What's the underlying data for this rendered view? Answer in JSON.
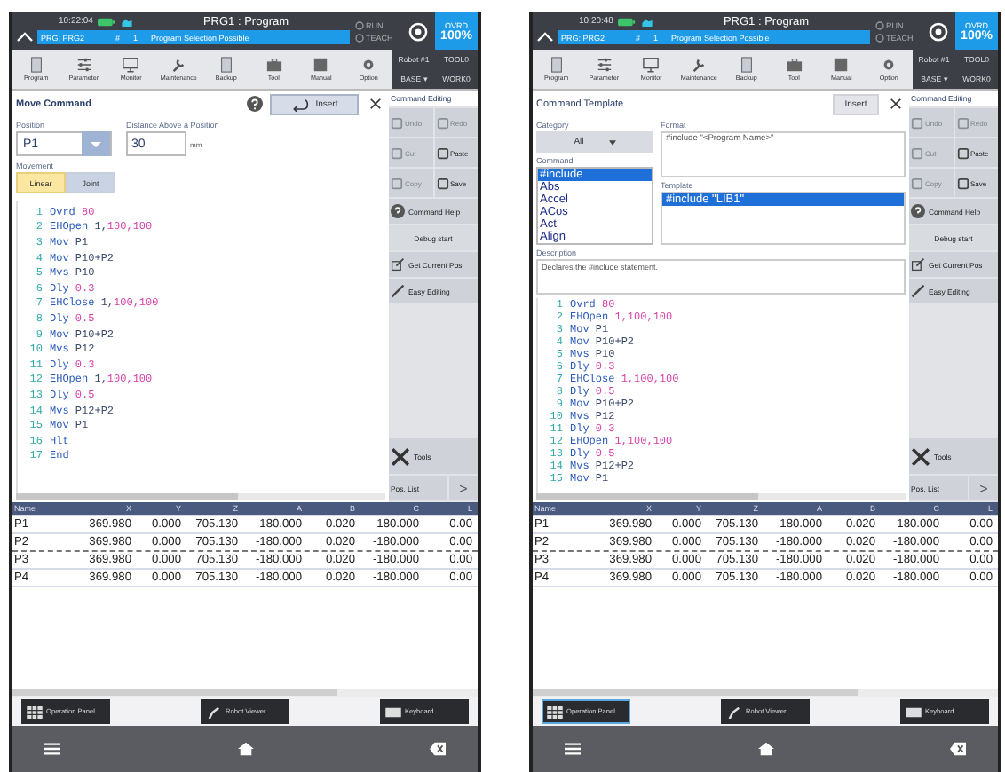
{
  "screens": [
    {
      "kind": "move_command",
      "status": {
        "time": "10:22:04",
        "title": "PRG1 : Program",
        "program": "PRG: PRG2",
        "slot_mark": "#",
        "slot": "1",
        "message": "Program Selection Possible",
        "run": "RUN",
        "teach": "TEACH",
        "ovrd_label": "OVRD",
        "ovrd": "100%",
        "robot": "Robot #1",
        "tool": "TOOL0",
        "base": "BASE ▾",
        "work": "WORK0"
      },
      "toolbar": [
        {
          "label": "Program"
        },
        {
          "label": "Parameter"
        },
        {
          "label": "Monitor"
        },
        {
          "label": "Maintenance"
        },
        {
          "label": "Backup"
        },
        {
          "label": "Tool"
        },
        {
          "label": "Manual"
        },
        {
          "label": "Option"
        }
      ],
      "editor": {
        "title": "Move Command",
        "insert": "Insert",
        "position_label": "Position",
        "position": "P1",
        "distance_label": "Distance Above a Position",
        "distance": "30",
        "unit": "mm",
        "movement_label": "Movement",
        "movements": [
          {
            "label": "Linear",
            "selected": true
          },
          {
            "label": "Joint",
            "selected": false
          }
        ]
      },
      "code": [
        {
          "num": "1",
          "cmd": "Ovrd",
          "args": [
            {
              "text": "80",
              "kind": "num"
            }
          ]
        },
        {
          "num": "2",
          "cmd": "EHOpen",
          "args": [
            {
              "text": "1,",
              "kind": "plain"
            },
            {
              "text": "100,100",
              "kind": "num"
            }
          ]
        },
        {
          "num": "3",
          "cmd": "Mov",
          "args": [
            {
              "text": "P1",
              "kind": "plain"
            }
          ]
        },
        {
          "num": "4",
          "cmd": "Mov",
          "args": [
            {
              "text": "P10+P2",
              "kind": "plain"
            }
          ]
        },
        {
          "num": "5",
          "cmd": "Mvs",
          "args": [
            {
              "text": "P10",
              "kind": "plain"
            }
          ]
        },
        {
          "num": "6",
          "cmd": "Dly",
          "args": [
            {
              "text": "0.3",
              "kind": "num"
            }
          ]
        },
        {
          "num": "7",
          "cmd": "EHClose",
          "args": [
            {
              "text": "1,",
              "kind": "plain"
            },
            {
              "text": "100,100",
              "kind": "num"
            }
          ]
        },
        {
          "num": "8",
          "cmd": "Dly",
          "args": [
            {
              "text": "0.5",
              "kind": "num"
            }
          ]
        },
        {
          "num": "9",
          "cmd": "Mov",
          "args": [
            {
              "text": "P10+P2",
              "kind": "plain"
            }
          ]
        },
        {
          "num": "10",
          "cmd": "Mvs",
          "args": [
            {
              "text": "P12",
              "kind": "plain"
            }
          ]
        },
        {
          "num": "11",
          "cmd": "Dly",
          "args": [
            {
              "text": "0.3",
              "kind": "num"
            }
          ]
        },
        {
          "num": "12",
          "cmd": "EHOpen",
          "args": [
            {
              "text": "1,",
              "kind": "plain"
            },
            {
              "text": "100,100",
              "kind": "num"
            }
          ]
        },
        {
          "num": "13",
          "cmd": "Dly",
          "args": [
            {
              "text": "0.5",
              "kind": "num"
            }
          ]
        },
        {
          "num": "14",
          "cmd": "Mvs",
          "args": [
            {
              "text": "P12+P2",
              "kind": "plain"
            }
          ]
        },
        {
          "num": "15",
          "cmd": "Mov",
          "args": [
            {
              "text": "P1",
              "kind": "plain"
            }
          ]
        },
        {
          "num": "16",
          "cmd": "Hlt"
        },
        {
          "num": "17",
          "cmd": "End"
        }
      ],
      "edit_title": "Command Editing",
      "edit_buttons": [
        {
          "label": "Undo",
          "disabled": true
        },
        {
          "label": "Redo",
          "disabled": true
        },
        {
          "label": "Cut",
          "disabled": true
        },
        {
          "label": "Paste",
          "disabled": false
        },
        {
          "label": "Copy",
          "disabled": true
        },
        {
          "label": "Save",
          "disabled": false
        }
      ],
      "help": "Command Help",
      "debug": "Debug start",
      "get_pos": "Get Current Pos",
      "easy": "Easy Editing",
      "tools": "Tools",
      "pos_list": "Pos. List",
      "next": ">",
      "table": {
        "columns": [
          "Name",
          "X",
          "Y",
          "Z",
          "A",
          "B",
          "C",
          "L"
        ],
        "rows": [
          [
            "P1",
            "369.980",
            "0.000",
            "705.130",
            "-180.000",
            "0.020",
            "-180.000",
            "0.00"
          ],
          [
            "P2",
            "369.980",
            "0.000",
            "705.130",
            "-180.000",
            "0.020",
            "-180.000",
            "0.00"
          ],
          [
            "P3",
            "369.980",
            "0.000",
            "705.130",
            "-180.000",
            "0.020",
            "-180.000",
            "0.00"
          ],
          [
            "P4",
            "369.980",
            "0.000",
            "705.130",
            "-180.000",
            "0.020",
            "-180.000",
            "0.00"
          ]
        ]
      },
      "bottom_tabs": [
        {
          "label": "Operation Panel",
          "selected": false
        },
        {
          "label": "Robot Viewer",
          "selected": false
        },
        {
          "label": "Keyboard",
          "selected": false
        }
      ]
    },
    {
      "kind": "command_template",
      "status": {
        "time": "10:20:48",
        "title": "PRG1 : Program",
        "program": "PRG: PRG2",
        "slot_mark": "#",
        "slot": "1",
        "message": "Program Selection Possible",
        "run": "RUN",
        "teach": "TEACH",
        "ovrd_label": "OVRD",
        "ovrd": "100%",
        "robot": "Robot #1",
        "tool": "TOOL0",
        "base": "BASE ▾",
        "work": "WORK0"
      },
      "toolbar": [
        {
          "label": "Program"
        },
        {
          "label": "Parameter"
        },
        {
          "label": "Monitor"
        },
        {
          "label": "Maintenance"
        },
        {
          "label": "Backup"
        },
        {
          "label": "Tool"
        },
        {
          "label": "Manual"
        },
        {
          "label": "Option"
        }
      ],
      "editor": {
        "title": "Command Template",
        "insert": "Insert",
        "category_label": "Category",
        "category": "All",
        "command_label": "Command",
        "commands": [
          {
            "label": "#include",
            "selected": true
          },
          {
            "label": "Abs",
            "selected": false
          },
          {
            "label": "Accel",
            "selected": false
          },
          {
            "label": "ACos",
            "selected": false
          },
          {
            "label": "Act",
            "selected": false
          },
          {
            "label": "Align",
            "selected": false
          }
        ],
        "format_label": "Format",
        "format": "#include \"<Program Name>\"",
        "template_label": "Template",
        "templates": [
          {
            "label": "#include \"LIB1\"",
            "selected": true
          }
        ],
        "description_label": "Description",
        "description": "Declares the #include statement."
      },
      "code": [
        {
          "num": "1",
          "cmd": "Ovrd",
          "args": [
            {
              "text": "80",
              "kind": "num"
            }
          ]
        },
        {
          "num": "2",
          "cmd": "EHOpen",
          "args": [
            {
              "text": "1,",
              "kind": "num"
            },
            {
              "text": "100,100",
              "kind": "num"
            }
          ]
        },
        {
          "num": "3",
          "cmd": "Mov",
          "args": [
            {
              "text": "P1",
              "kind": "plain"
            }
          ]
        },
        {
          "num": "4",
          "cmd": "Mov",
          "args": [
            {
              "text": "P10+P2",
              "kind": "plain"
            }
          ]
        },
        {
          "num": "5",
          "cmd": "Mvs",
          "args": [
            {
              "text": "P10",
              "kind": "plain"
            }
          ]
        },
        {
          "num": "6",
          "cmd": "Dly",
          "args": [
            {
              "text": "0.3",
              "kind": "num"
            }
          ]
        },
        {
          "num": "7",
          "cmd": "EHClose",
          "args": [
            {
              "text": "1,",
              "kind": "num"
            },
            {
              "text": "100,100",
              "kind": "num"
            }
          ]
        },
        {
          "num": "8",
          "cmd": "Dly",
          "args": [
            {
              "text": "0.5",
              "kind": "num"
            }
          ]
        },
        {
          "num": "9",
          "cmd": "Mov",
          "args": [
            {
              "text": "P10+P2",
              "kind": "plain"
            }
          ]
        },
        {
          "num": "10",
          "cmd": "Mvs",
          "args": [
            {
              "text": "P12",
              "kind": "plain"
            }
          ]
        },
        {
          "num": "11",
          "cmd": "Dly",
          "args": [
            {
              "text": "0.3",
              "kind": "num"
            }
          ]
        },
        {
          "num": "12",
          "cmd": "EHOpen",
          "args": [
            {
              "text": "1,",
              "kind": "num"
            },
            {
              "text": "100,100",
              "kind": "num"
            }
          ]
        },
        {
          "num": "13",
          "cmd": "Dly",
          "args": [
            {
              "text": "0.5",
              "kind": "num"
            }
          ]
        },
        {
          "num": "14",
          "cmd": "Mvs",
          "args": [
            {
              "text": "P12+P2",
              "kind": "plain"
            }
          ]
        },
        {
          "num": "15",
          "cmd": "Mov",
          "args": [
            {
              "text": "P1",
              "kind": "plain"
            }
          ]
        }
      ],
      "edit_title": "Command Editing",
      "edit_buttons": [
        {
          "label": "Undo",
          "disabled": true
        },
        {
          "label": "Redo",
          "disabled": true
        },
        {
          "label": "Cut",
          "disabled": true
        },
        {
          "label": "Paste",
          "disabled": false
        },
        {
          "label": "Copy",
          "disabled": true
        },
        {
          "label": "Save",
          "disabled": false
        }
      ],
      "help": "Command Help",
      "debug": "Debug start",
      "get_pos": "Get Current Pos",
      "easy": "Easy Editing",
      "tools": "Tools",
      "pos_list": "Pos. List",
      "next": ">",
      "table": {
        "columns": [
          "Name",
          "X",
          "Y",
          "Z",
          "A",
          "B",
          "C",
          "L"
        ],
        "rows": [
          [
            "P1",
            "369.980",
            "0.000",
            "705.130",
            "-180.000",
            "0.020",
            "-180.000",
            "0.00"
          ],
          [
            "P2",
            "369.980",
            "0.000",
            "705.130",
            "-180.000",
            "0.020",
            "-180.000",
            "0.00"
          ],
          [
            "P3",
            "369.980",
            "0.000",
            "705.130",
            "-180.000",
            "0.020",
            "-180.000",
            "0.00"
          ],
          [
            "P4",
            "369.980",
            "0.000",
            "705.130",
            "-180.000",
            "0.020",
            "-180.000",
            "0.00"
          ]
        ]
      },
      "bottom_tabs": [
        {
          "label": "Operation Panel",
          "selected": true
        },
        {
          "label": "Robot Viewer",
          "selected": false
        },
        {
          "label": "Keyboard",
          "selected": false
        }
      ]
    }
  ]
}
